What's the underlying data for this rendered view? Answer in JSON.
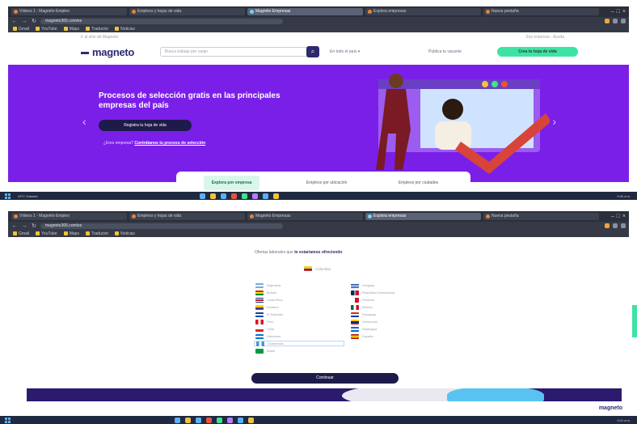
{
  "shot1": {
    "tabs": [
      "Vídeos 1 - Magnéto Empleo",
      "Empleos y hojas de vida",
      "Magnéto Empresas",
      "Explora empresas",
      "Nueva pestaña"
    ],
    "url": "magneto365.com/es",
    "bookmarks": [
      "Gmail",
      "YouTube",
      "Maps",
      "Traductor",
      "Noticias"
    ],
    "site": {
      "topline": "Ir al sitio de Magneto",
      "topright": "Soy empresa · Ayuda",
      "logo": "magneto",
      "search_placeholder": "Busca trabajo por cargo",
      "search_button": "⌕",
      "location": "En todo el país ▾",
      "publish": "Publica tu vacante",
      "cv_button": "Crea tu hoja de vida"
    },
    "hero": {
      "title": "Procesos de selección gratis en las principales empresas del país",
      "button": "Registra tu hoja de vida",
      "link_prefix": "¿Eres empresa?",
      "link_text": "Contrátanos tu proceso de selección",
      "prev": "‹",
      "next": "›"
    },
    "tabs_bar": [
      "Explora por empresa",
      "Empleos por ubicación",
      "Empleos por ciudades"
    ],
    "taskbar": {
      "weather": "28°C Soleado",
      "time": "9:40 a.m."
    }
  },
  "shot2": {
    "title_prefix": "Ofertas laborales que",
    "title_bold": "te estaríamos ofreciendo",
    "selected": "Colombia",
    "countries_left": [
      "Argentina",
      "Bolivia",
      "Costa Rica",
      "Ecuador",
      "El Salvador",
      "Perú",
      "Chile",
      "Honduras",
      "Guatemala",
      "Brasil"
    ],
    "countries_right": [
      "Uruguay",
      "República Dominicana",
      "Panamá",
      "México",
      "Paraguay",
      "Venezuela",
      "Nicaragua",
      "España"
    ],
    "continue": "Continuar",
    "footer_logo": "magneto",
    "taskbar": {
      "time": "9:41 a.m."
    }
  },
  "colors": {
    "hero_bg": "#7a1fe8",
    "brand_dark": "#1e1b4a",
    "accent_green": "#3ee3a3"
  }
}
